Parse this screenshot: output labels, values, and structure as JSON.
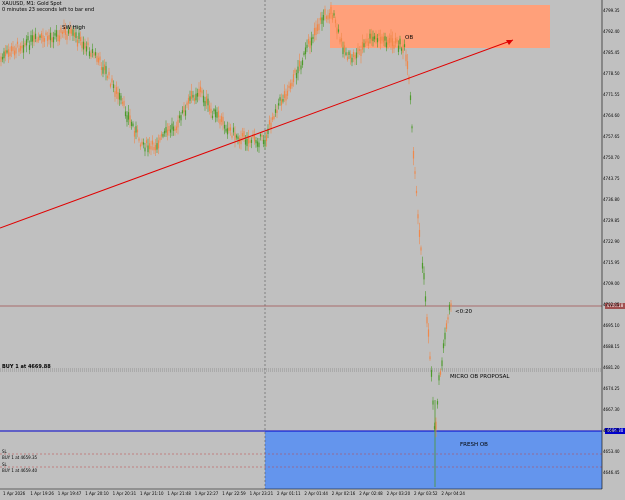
{
  "header": {
    "symbol_line": "XAUUSD, M1:  Gold Spot",
    "timer_line": "0 minutes 23 seconds left to bar end"
  },
  "annotations": {
    "swing_high": "SW High",
    "ob": "OB",
    "micro_ob": "MICRO OB PROPOSAL",
    "fresh_ob": "FRESH OB",
    "timer": "<0:20"
  },
  "orders": {
    "buy_main": "BUY 1 at 4669.88",
    "sl_label": "SL",
    "buy_low1": "BUY 1 at 4659.35",
    "buy_low2": "BUY 1 at 4659.40"
  },
  "price_tags": {
    "current": "4709.18",
    "fresh_ob_top": "4666.30"
  },
  "y_axis": [
    "4799.35",
    "4792.40",
    "4785.45",
    "4778.50",
    "4771.55",
    "4764.60",
    "4757.65",
    "4750.70",
    "4743.75",
    "4736.80",
    "4729.85",
    "4722.90",
    "4715.95",
    "4709.00",
    "4702.05",
    "4695.10",
    "4688.15",
    "4681.20",
    "4674.25",
    "4667.30",
    "4660.35",
    "4653.40",
    "4646.45"
  ],
  "x_axis": [
    "1 Apr 2026",
    "1 Apr 19:26",
    "1 Apr 19:47",
    "1 Apr 20:10",
    "1 Apr 20:31",
    "1 Apr 21:10",
    "1 Apr 21:48",
    "1 Apr 22:27",
    "1 Apr 22:59",
    "1 Apr 23:21",
    "2 Apr 01:11",
    "2 Apr 01:44",
    "2 Apr 02:16",
    "2 Apr 02:48",
    "2 Apr 03:20",
    "2 Apr 03:52",
    "2 Apr 04:24"
  ],
  "colors": {
    "background": "#c0c0c0",
    "bull": "#4c9a2a",
    "bear": "#f0884a",
    "ob_zone": "#ffa07a",
    "fresh_ob_zone": "#6495ed",
    "trendline": "#e00000",
    "price_line": "#a05050",
    "fresh_line": "#0000cc"
  }
}
